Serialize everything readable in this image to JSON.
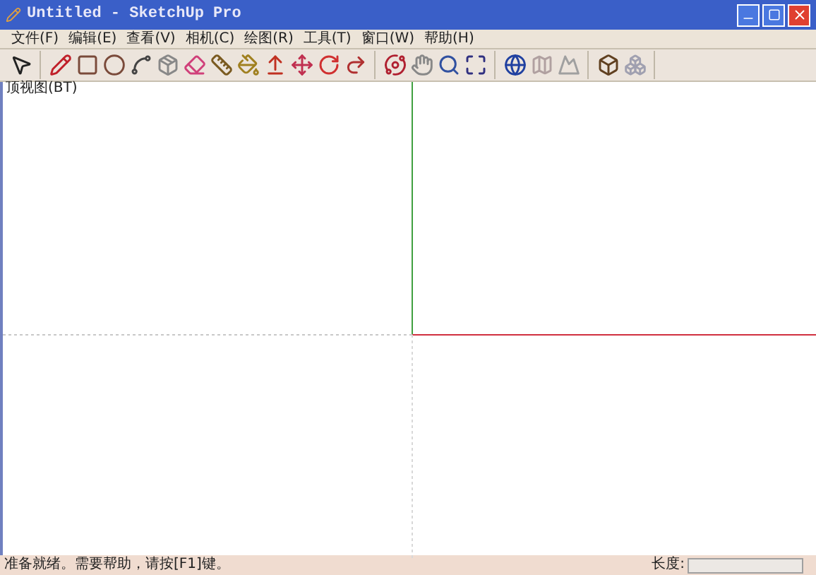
{
  "window": {
    "title": "Untitled - SketchUp Pro"
  },
  "menu": [
    "文件(F)",
    "编辑(E)",
    "查看(V)",
    "相机(C)",
    "绘图(R)",
    "工具(T)",
    "窗口(W)",
    "帮助(H)"
  ],
  "viewport": {
    "view_label": "顶视图(BT)"
  },
  "status_bar": {
    "message": "准备就绪。需要帮助，请按[F1]键。",
    "measurement_label": "长度:"
  }
}
